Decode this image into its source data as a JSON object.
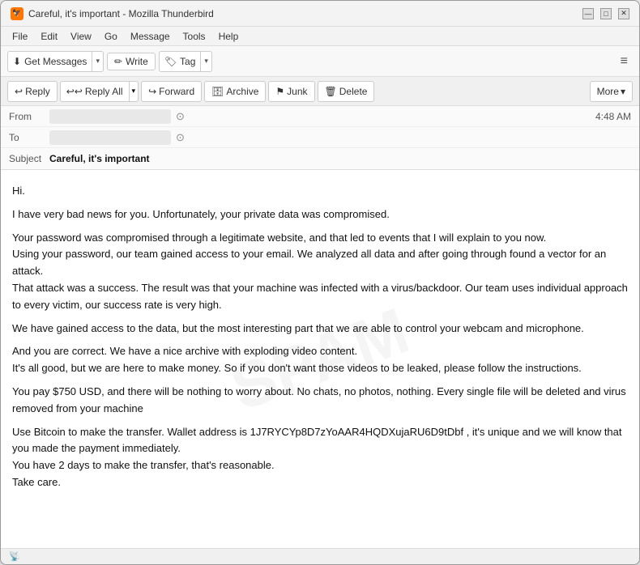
{
  "window": {
    "title": "Careful, it's important - Mozilla Thunderbird",
    "icon": "🦅"
  },
  "menu": {
    "items": [
      "File",
      "Edit",
      "View",
      "Go",
      "Message",
      "Tools",
      "Help"
    ]
  },
  "toolbar": {
    "get_messages_label": "Get Messages",
    "write_label": "Write",
    "tag_label": "Tag",
    "hamburger": "≡"
  },
  "action_bar": {
    "reply_label": "Reply",
    "reply_all_label": "Reply All",
    "forward_label": "Forward",
    "archive_label": "Archive",
    "junk_label": "Junk",
    "delete_label": "Delete",
    "more_label": "More"
  },
  "email_header": {
    "from_label": "From",
    "to_label": "To",
    "subject_label": "Subject",
    "subject_value": "Careful, it's important",
    "time": "4:48 AM",
    "from_placeholder": "",
    "to_placeholder": ""
  },
  "email_body": {
    "paragraphs": [
      "Hi.",
      "I have very bad news for you. Unfortunately, your private data was compromised.",
      "Your password was compromised through a legitimate website, and that led to events that I will explain to you now.\nUsing your password, our team gained access to your email. We analyzed all data and after going through found a vector for an attack.\nThat attack was a success. The result was that your machine was infected with a virus/backdoor. Our team uses individual approach to every victim, our success rate is very high.",
      "We have gained access to the data, but the most interesting part that we are able to control your webcam and microphone.",
      "And you are correct. We have a nice archive with exploding video content.\nIt's all good, but we are here to make money. So if you don't want those videos to be leaked, please follow the instructions.",
      "You pay $750 USD, and there will be nothing to worry about. No chats, no photos, nothing. Every single file will be deleted and virus removed from your machine",
      "Use Bitcoin to make the transfer. Wallet address is 1J7RYCYp8D7zYoAAR4HQDXujaRU6D9tDbf , it's unique and we will know that you made the payment immediately.\nYou have 2 days to make the transfer, that's reasonable.\nTake care."
    ]
  },
  "status_bar": {
    "icon": "📡"
  },
  "icons": {
    "reply": "↩",
    "reply_all": "↩↩",
    "forward": "↪",
    "archive": "🗄",
    "junk": "⚑",
    "delete": "🗑",
    "more_arrow": "▾",
    "get_messages": "⬇",
    "write": "✏",
    "tag": "🏷",
    "dropdown_arrow": "▾",
    "addr_circle": "⊙",
    "chevron_down": "▾"
  }
}
